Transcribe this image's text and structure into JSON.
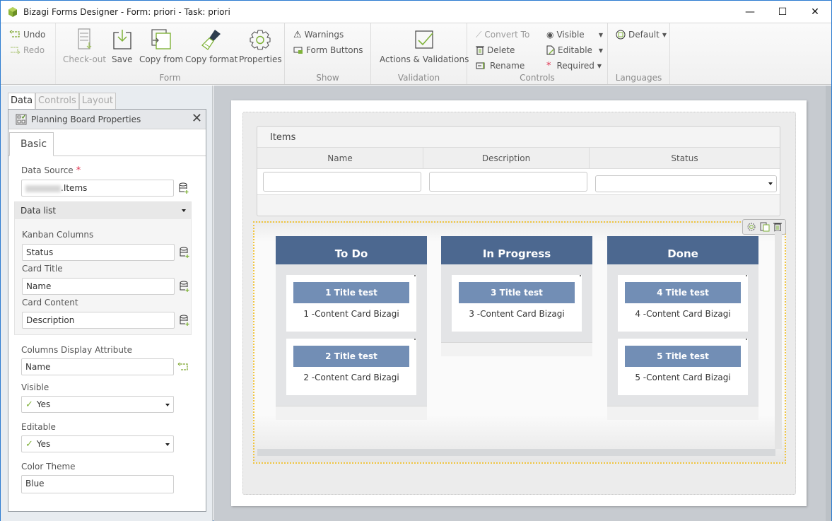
{
  "window": {
    "title": "Bizagi Forms Designer  - Form: priori - Task:  priori",
    "controls": {
      "minimize": "—",
      "maximize": "☐",
      "close": "✕"
    }
  },
  "ribbon": {
    "undo": "Undo",
    "redo": "Redo",
    "form_group": {
      "label": "Form",
      "buttons": {
        "checkout": "Check-out",
        "save": "Save",
        "copy_from": "Copy from",
        "copy_format": "Copy format",
        "properties": "Properties"
      }
    },
    "show_group": {
      "label": "Show",
      "warnings": "Warnings",
      "form_buttons": "Form Buttons"
    },
    "validation_group": {
      "label": "Validation",
      "actions_validations": "Actions & Validations"
    },
    "controls_group": {
      "label": "Controls",
      "convert_to": "Convert To",
      "delete": "Delete",
      "rename": "Rename",
      "visible": "Visible",
      "editable": "Editable",
      "required": "Required"
    },
    "languages_group": {
      "label": "Languages",
      "default": "Default"
    }
  },
  "left_panel": {
    "tabs": [
      {
        "label": "Data",
        "active": true
      },
      {
        "label": "Controls",
        "active": false
      },
      {
        "label": "Layout",
        "active": false
      }
    ],
    "properties": {
      "title": "Planning Board Properties",
      "subtab": "Basic",
      "data_source_label": "Data Source",
      "required_marker": "*",
      "data_source_value": ".Items",
      "data_list_label": "Data list",
      "kanban_columns_label": "Kanban Columns",
      "kanban_columns_value": "Status",
      "card_title_label": "Card Title",
      "card_title_value": "Name",
      "card_content_label": "Card Content",
      "card_content_value": "Description",
      "columns_display_label": "Columns Display Attribute",
      "columns_display_value": "Name",
      "visible_label": "Visible",
      "visible_value": "Yes",
      "editable_label": "Editable",
      "editable_value": "Yes",
      "color_theme_label": "Color Theme",
      "color_theme_value": "Blue"
    }
  },
  "form": {
    "grid": {
      "title": "Items",
      "columns": [
        "Name",
        "Description",
        "Status"
      ]
    },
    "board": {
      "columns": [
        {
          "title": "To Do",
          "cards": [
            {
              "title": "1 Title test",
              "content": "1 -Content Card Bizagi"
            },
            {
              "title": "2 Title test",
              "content": "2 -Content Card Bizagi"
            }
          ]
        },
        {
          "title": "In Progress",
          "cards": [
            {
              "title": "3 Title test",
              "content": "3 -Content Card Bizagi"
            }
          ]
        },
        {
          "title": "Done",
          "cards": [
            {
              "title": "4 Title test",
              "content": "4 -Content Card Bizagi"
            },
            {
              "title": "5 Title test",
              "content": "5 -Content Card Bizagi"
            }
          ]
        }
      ]
    }
  },
  "colors": {
    "column_header": "#4c6890",
    "card_title": "#728eb5",
    "selection_outline": "#f0c540",
    "accent_green": "#7fb239",
    "required_red": "#e0304e"
  }
}
